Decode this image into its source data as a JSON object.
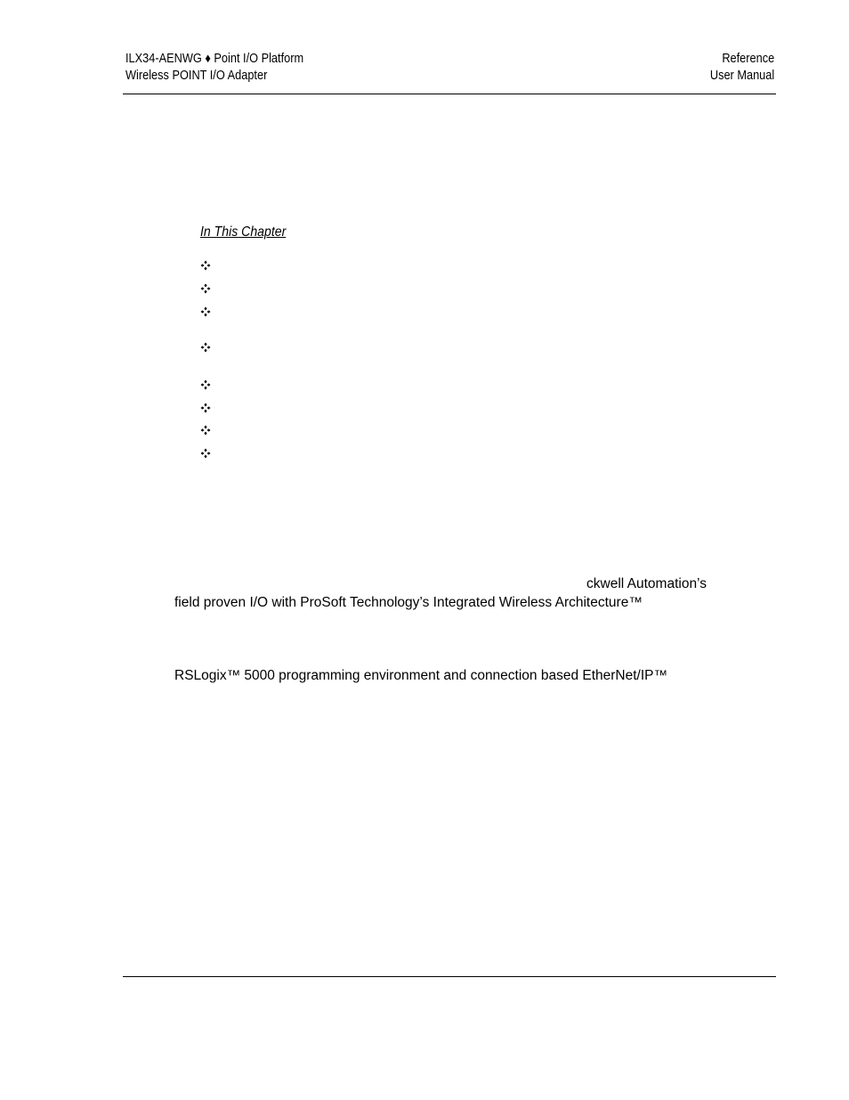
{
  "header": {
    "left_line1": "ILX34-AENWG ♦ Point I/O Platform",
    "left_line2": "Wireless POINT I/O Adapter",
    "right_line1": "Reference",
    "right_line2": "User Manual"
  },
  "chapter": {
    "heading": "In This Chapter",
    "bullet_count": 8,
    "bullet_icon": "four-diamond-bullet-icon"
  },
  "body": {
    "line1": "ckwell Automation’s",
    "line2": "field proven I/O with ProSoft Technology’s Integrated Wireless Architecture™",
    "line3": "RSLogix™ 5000 programming environment and connection based EtherNet/IP™"
  }
}
